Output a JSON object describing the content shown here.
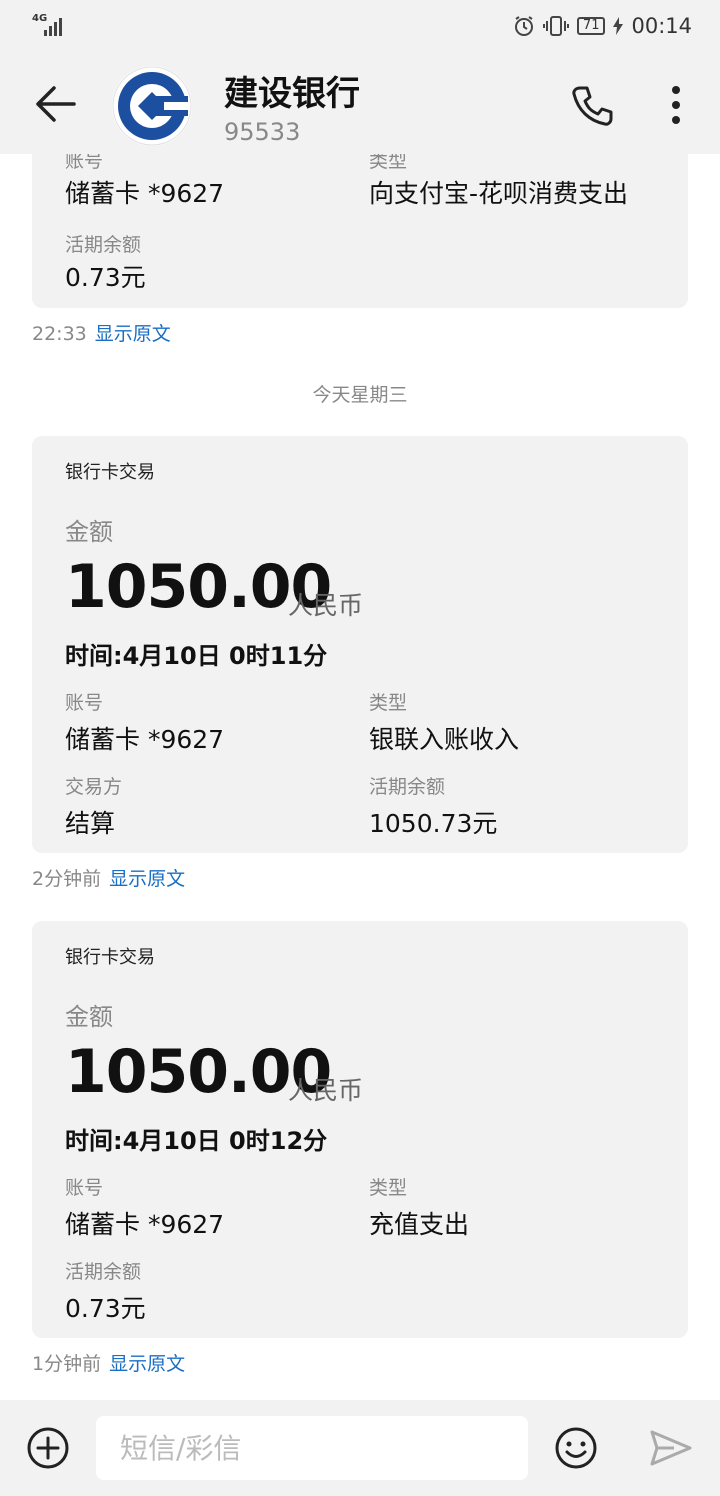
{
  "status_bar": {
    "network": "4G",
    "battery": "71",
    "time": "00:14"
  },
  "header": {
    "title": "建设银行",
    "number": "95533"
  },
  "messages": [
    {
      "fields": [
        {
          "label": "账号",
          "value": "储蓄卡 *9627"
        },
        {
          "label": "类型",
          "value": "向支付宝-花呗消费支出"
        },
        {
          "label": "活期余额",
          "value": "0.73元"
        }
      ],
      "timestamp": "22:33",
      "show_original": "显示原文"
    },
    {
      "card_title": "银行卡交易",
      "amount_label": "金额",
      "amount": "1050.00",
      "currency": "人民币",
      "time_line": "时间:4月10日 0时11分",
      "fields": [
        {
          "label": "账号",
          "value": "储蓄卡 *9627"
        },
        {
          "label": "类型",
          "value": "银联入账收入"
        },
        {
          "label": "交易方",
          "value": "结算"
        },
        {
          "label": "活期余额",
          "value": "1050.73元"
        }
      ],
      "timestamp": "2分钟前",
      "show_original": "显示原文"
    },
    {
      "card_title": "银行卡交易",
      "amount_label": "金额",
      "amount": "1050.00",
      "currency": "人民币",
      "time_line": "时间:4月10日 0时12分",
      "fields": [
        {
          "label": "账号",
          "value": "储蓄卡 *9627"
        },
        {
          "label": "类型",
          "value": "充值支出"
        },
        {
          "label": "活期余额",
          "value": "0.73元"
        }
      ],
      "timestamp": "1分钟前",
      "show_original": "显示原文"
    }
  ],
  "day_separator": "今天星期三",
  "input_bar": {
    "placeholder": "短信/彩信"
  },
  "colors": {
    "bar_background": "#f2f2f2",
    "card_background": "#f2f2f2",
    "link": "#1a6fc4",
    "bank_blue": "#1d4fa0"
  },
  "icons": [
    "back-arrow-icon",
    "ccb-logo-icon",
    "phone-icon",
    "more-vertical-icon",
    "alarm-icon",
    "vibrate-icon",
    "charging-icon",
    "add-icon",
    "emoji-icon",
    "send-icon"
  ]
}
